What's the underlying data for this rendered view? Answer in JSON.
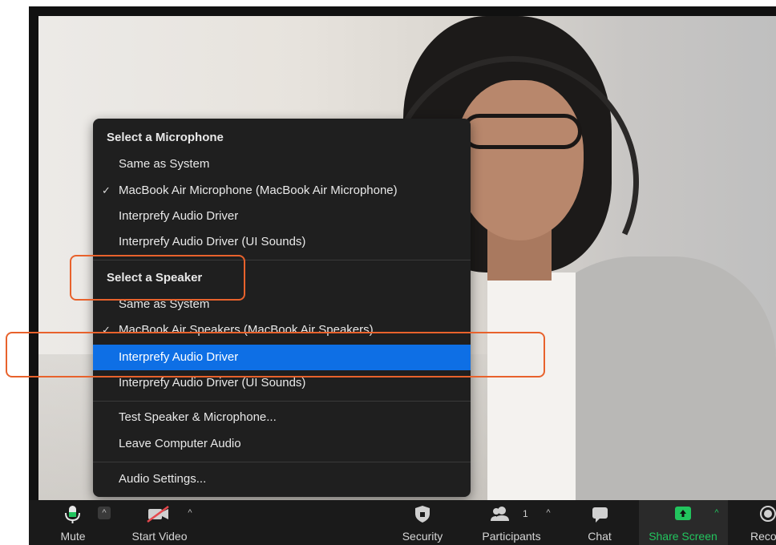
{
  "audio_menu": {
    "microphone_header": "Select a Microphone",
    "microphones": [
      {
        "label": "Same as System",
        "checked": false
      },
      {
        "label": "MacBook Air Microphone (MacBook Air Microphone)",
        "checked": true
      },
      {
        "label": "Interprefy Audio Driver",
        "checked": false
      },
      {
        "label": "Interprefy Audio Driver (UI Sounds)",
        "checked": false
      }
    ],
    "speaker_header": "Select a Speaker",
    "speakers": [
      {
        "label": "Same as System",
        "checked": false
      },
      {
        "label": "MacBook Air Speakers (MacBook Air Speakers)",
        "checked": true
      },
      {
        "label": "Interprefy Audio Driver",
        "checked": false,
        "selected": true
      },
      {
        "label": "Interprefy Audio Driver (UI Sounds)",
        "checked": false
      }
    ],
    "actions": [
      {
        "label": "Test Speaker & Microphone..."
      },
      {
        "label": "Leave Computer Audio"
      }
    ],
    "settings": "Audio Settings...",
    "check_glyph": "✓",
    "highlight_color": "#0e6fe5",
    "annotation_color": "#e8622c"
  },
  "toolbar": {
    "mute": "Mute",
    "start_video": "Start Video",
    "security": "Security",
    "participants": "Participants",
    "participants_count": "1",
    "chat": "Chat",
    "share_screen": "Share Screen",
    "record": "Reco",
    "caret": "^",
    "icons": {
      "mute": "microphone-icon",
      "video": "video-off-icon",
      "security": "shield-icon",
      "participants": "participants-icon",
      "chat": "chat-bubble-icon",
      "share": "share-screen-icon",
      "record": "record-icon"
    },
    "share_color": "#22c55e"
  }
}
